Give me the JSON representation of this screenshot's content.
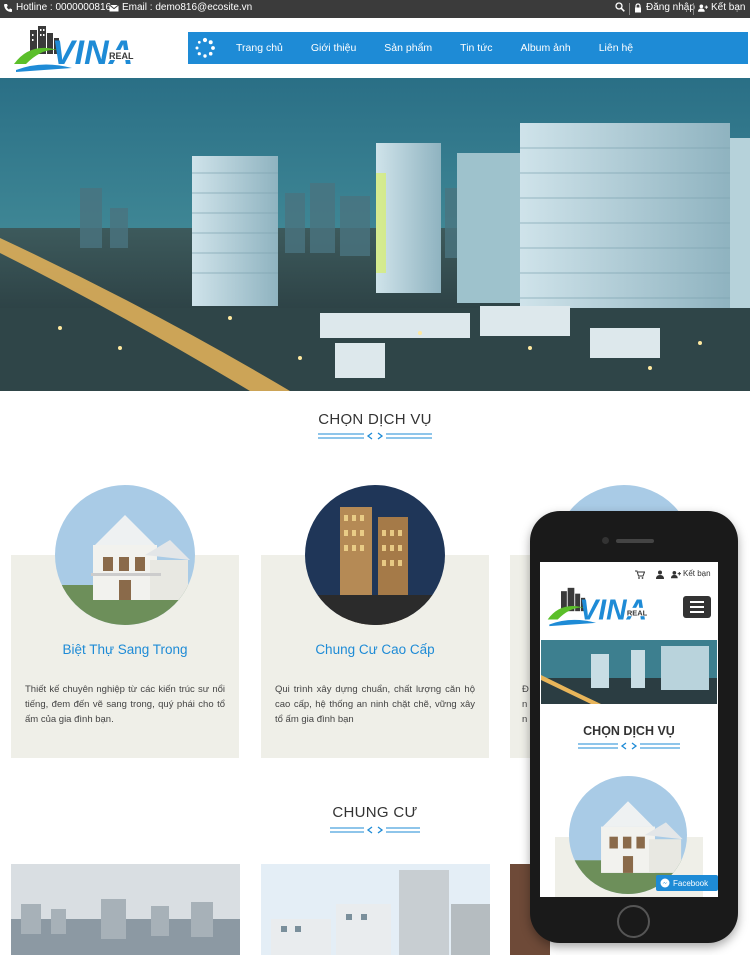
{
  "topbar": {
    "hotline": "Hotline : 0000000816",
    "email": "Email : demo816@ecosite.vn",
    "login": "Đăng nhập",
    "cart": "Kết bạn"
  },
  "nav": {
    "items": [
      "Trang chủ",
      "Giới thiệu",
      "Sản phẩm",
      "Tin tức",
      "Album ảnh",
      "Liên hệ"
    ]
  },
  "logo": {
    "text": "VINA",
    "sub": "REAL"
  },
  "services": {
    "title": "CHỌN DỊCH VỤ",
    "cards": [
      {
        "title": "Biệt Thự Sang Trong",
        "desc": "Thiết kế chuyên nghiệp từ các kiến trúc sư nổi tiếng, đem đến vẽ sang trong, quý phái cho tổ ấm của gia đình bạn."
      },
      {
        "title": "Chung Cư Cao Cấp",
        "desc": "Qui trình xây dựng chuẩn, chất lượng căn hộ cao cấp, hệ thống an ninh chặt chẽ, vững xây tổ ấm gia đình bạn"
      },
      {
        "title": "",
        "desc": "Đ\nn\nn"
      }
    ]
  },
  "apartments": {
    "title": "CHUNG CƯ"
  },
  "mobile": {
    "cart": "Kết bạn",
    "title": "CHỌN DỊCH VỤ",
    "facebook": "Facebook"
  },
  "colors": {
    "accent": "#1e8bd6",
    "topbar": "#3b3b3b",
    "card": "#efefe8"
  }
}
